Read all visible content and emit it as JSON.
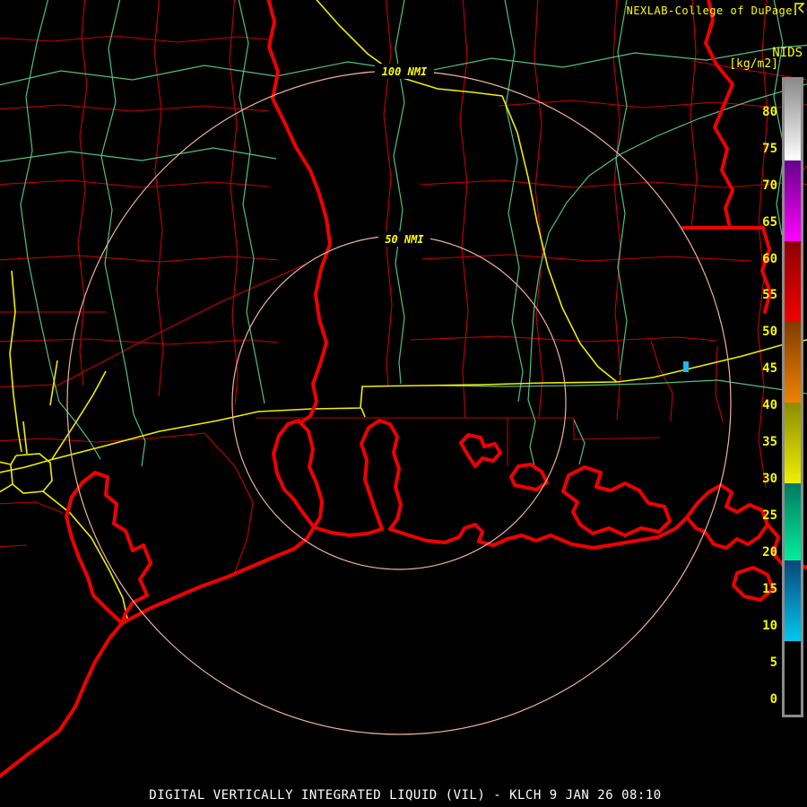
{
  "header": {
    "attribution": "NEXLAB-College of DuPage",
    "logo_icon": "cod-flag-icon"
  },
  "scale": {
    "product_label": "NIDS",
    "units_label": "[kg/m2]",
    "range": {
      "min": -2,
      "max": 84.5
    },
    "ticks": [
      "80",
      "75",
      "70",
      "65",
      "60",
      "55",
      "50",
      "45",
      "40",
      "35",
      "30",
      "25",
      "20",
      "15",
      "10",
      "5",
      "0"
    ],
    "segments": [
      {
        "name": "gray",
        "from": 84.5,
        "to": 73.5,
        "top": "#8c8c8c",
        "bottom": "#ffffff"
      },
      {
        "name": "purple-magenta",
        "from": 73.5,
        "to": 62.5,
        "top": "#64008c",
        "bottom": "#ff00ff"
      },
      {
        "name": "darkred-red",
        "from": 62.5,
        "to": 51.5,
        "top": "#8c0000",
        "bottom": "#f00000"
      },
      {
        "name": "brown-orange",
        "from": 51.5,
        "to": 40.5,
        "top": "#823c00",
        "bottom": "#f08200"
      },
      {
        "name": "olive-yellow",
        "from": 40.5,
        "to": 29.5,
        "top": "#8c8c00",
        "bottom": "#f0f000"
      },
      {
        "name": "teal-green",
        "from": 29.5,
        "to": 19.0,
        "top": "#00785f",
        "bottom": "#00f09b"
      },
      {
        "name": "blue-cyan",
        "from": 19.0,
        "to": 8.0,
        "top": "#0a4678",
        "bottom": "#00c8f0"
      },
      {
        "name": "black",
        "from": 8.0,
        "to": -2.0,
        "top": "#000000",
        "bottom": "#000000"
      }
    ]
  },
  "rings": {
    "inner": {
      "label": "50 NMI",
      "radius_nmi": 50
    },
    "outer": {
      "label": "100 NMI",
      "radius_nmi": 100
    }
  },
  "echo": {
    "color": "#1cb8f0",
    "note": "small cyan VIL return northeast of radar"
  },
  "footer": {
    "title": "DIGITAL VERTICALLY INTEGRATED LIQUID (VIL) - KLCH 9 JAN 26 08:10"
  },
  "colors": {
    "background": "#000000",
    "county_lines": "#c80000",
    "water_features": "#f00000",
    "rivers": "#50c080",
    "highways": "#f2ee00",
    "range_rings": "#f0b29a",
    "map_labels": "#ffff00",
    "scale_labels": "#f8f800",
    "scale_border": "#8c8c8c",
    "header_text": "#ffff00",
    "footer_text": "#ffffff",
    "echo": "#1cb8f0"
  }
}
